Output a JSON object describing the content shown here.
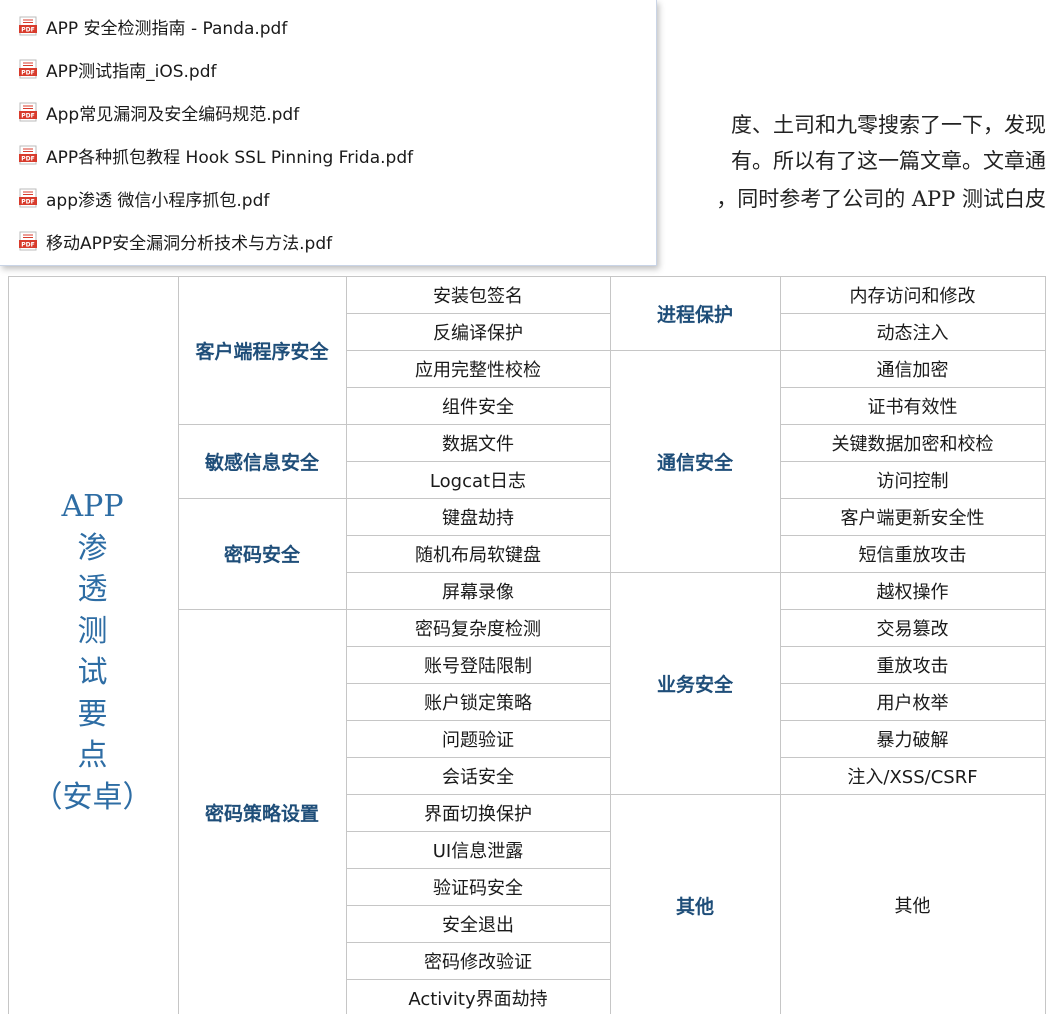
{
  "article": {
    "line1": "度、土司和九零搜索了一下，发现",
    "line2": "有。所以有了这一篇文章。文章通",
    "line3": "，同时参考了公司的 APP 测试白皮"
  },
  "files": [
    "APP 安全检测指南 - Panda.pdf",
    "APP测试指南_iOS.pdf",
    "App常见漏洞及安全编码规范.pdf",
    "APP各种抓包教程 Hook  SSL Pinning Frida.pdf",
    "app渗透 微信小程序抓包.pdf",
    "移动APP安全漏洞分析技术与方法.pdf"
  ],
  "file_icon": "pdf-file-icon",
  "table": {
    "title_chars": [
      "APP",
      "渗",
      "透",
      "测",
      "试",
      "要",
      "点",
      "（安卓）"
    ],
    "left_categories": [
      "客户端程序安全",
      "敏感信息安全",
      "密码安全",
      "密码策略设置"
    ],
    "left_items": [
      "安装包签名",
      "反编译保护",
      "应用完整性校检",
      "组件安全",
      "数据文件",
      "Logcat日志",
      "键盘劫持",
      "随机布局软键盘",
      "屏幕录像",
      "密码复杂度检测",
      "账号登陆限制",
      "账户锁定策略",
      "问题验证",
      "会话安全",
      "界面切换保护",
      "UI信息泄露",
      "验证码安全",
      "安全退出",
      "密码修改验证",
      "Activity界面劫持"
    ],
    "right_categories": [
      "进程保护",
      "通信安全",
      "业务安全",
      "其他"
    ],
    "right_items": [
      "内存访问和修改",
      "动态注入",
      "通信加密",
      "证书有效性",
      "关键数据加密和校检",
      "访问控制",
      "客户端更新安全性",
      "短信重放攻击",
      "越权操作",
      "交易篡改",
      "重放攻击",
      "用户枚举",
      "暴力破解",
      "注入/XSS/CSRF",
      "其他"
    ]
  },
  "colors": {
    "category": "#1f4e79",
    "title": "#2e6da4",
    "grid": "#c6c6c6"
  }
}
